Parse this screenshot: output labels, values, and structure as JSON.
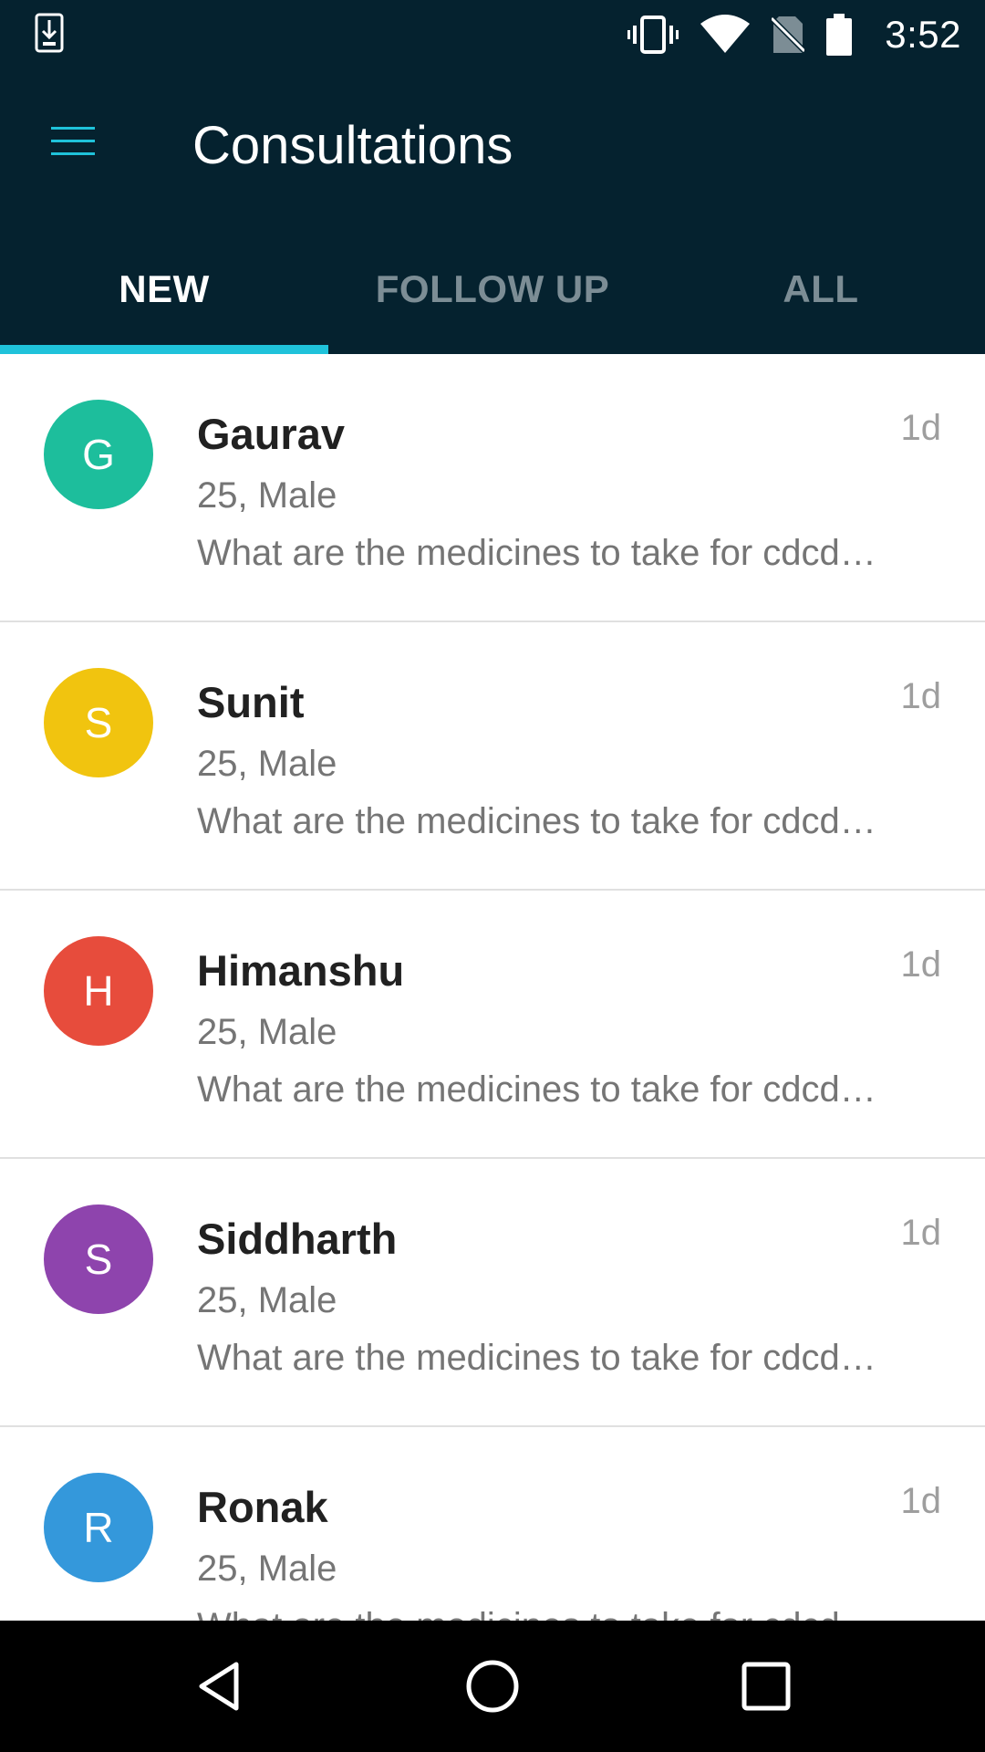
{
  "status_bar": {
    "time": "3:52",
    "icons": [
      "download-icon",
      "vibrate-icon",
      "wifi-icon",
      "no-sim-icon",
      "battery-icon"
    ]
  },
  "app_bar": {
    "title": "Consultations",
    "menu_icon": "menu-icon"
  },
  "tabs": [
    {
      "label": "NEW",
      "active": true
    },
    {
      "label": "FOLLOW UP",
      "active": false
    },
    {
      "label": "ALL",
      "active": false
    }
  ],
  "colors": {
    "header_bg": "#05222f",
    "tab_indicator": "#1fc2da",
    "menu_icon": "#1fc2da"
  },
  "consultations": [
    {
      "initial": "G",
      "name": "Gaurav",
      "meta": "25, Male",
      "preview": "What are the medicines to take for cdcd…",
      "time": "1d",
      "color": "#1dbe9c"
    },
    {
      "initial": "S",
      "name": "Sunit",
      "meta": "25, Male",
      "preview": "What are the medicines to take for cdcd…",
      "time": "1d",
      "color": "#f1c40f"
    },
    {
      "initial": "H",
      "name": "Himanshu",
      "meta": "25, Male",
      "preview": "What are the medicines to take for cdcd…",
      "time": "1d",
      "color": "#e74c3c"
    },
    {
      "initial": "S",
      "name": "Siddharth",
      "meta": "25, Male",
      "preview": "What are the medicines to take for cdcd…",
      "time": "1d",
      "color": "#8e44ad"
    },
    {
      "initial": "R",
      "name": "Ronak",
      "meta": "25, Male",
      "preview": "What are the medicines to take for cdcd…",
      "time": "1d",
      "color": "#3498db"
    }
  ],
  "nav_bar": {
    "icons": [
      "back-icon",
      "home-icon",
      "recents-icon"
    ]
  }
}
